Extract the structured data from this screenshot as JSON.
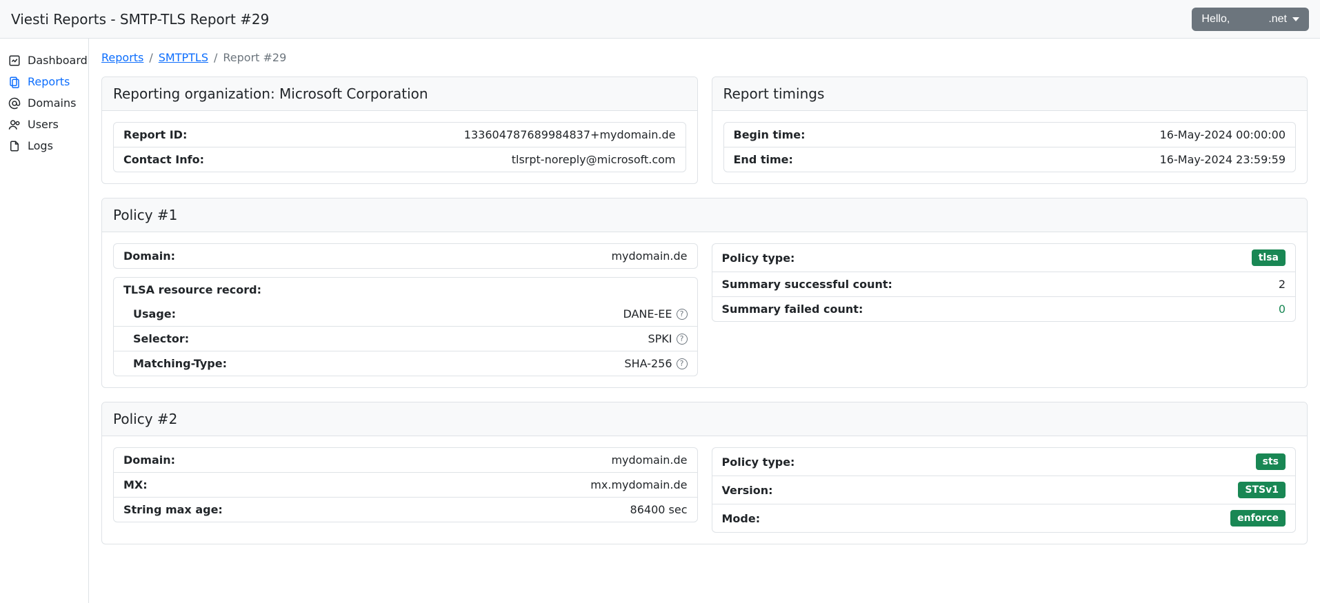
{
  "header": {
    "title": "Viesti Reports - SMTP-TLS Report #29",
    "hello": "Hello,",
    "user": ".net"
  },
  "sidebar": {
    "items": [
      {
        "label": "Dashboard"
      },
      {
        "label": "Reports"
      },
      {
        "label": "Domains"
      },
      {
        "label": "Users"
      },
      {
        "label": "Logs"
      }
    ]
  },
  "breadcrumb": {
    "reports": "Reports",
    "smtptls": "SMTPTLS",
    "current": "Report #29"
  },
  "reporting_org": {
    "title": "Reporting organization: Microsoft Corporation",
    "report_id_label": "Report ID:",
    "report_id_value": "133604787689984837+mydomain.de",
    "contact_label": "Contact Info:",
    "contact_value": "tlsrpt-noreply@microsoft.com"
  },
  "timings": {
    "title": "Report timings",
    "begin_label": "Begin time:",
    "begin_value": "16-May-2024 00:00:00",
    "end_label": "End time:",
    "end_value": "16-May-2024 23:59:59"
  },
  "policy1": {
    "title": "Policy #1",
    "domain_label": "Domain:",
    "domain_value": "mydomain.de",
    "tlsa_title": "TLSA resource record:",
    "usage_label": "Usage:",
    "usage_value": "DANE-EE",
    "selector_label": "Selector:",
    "selector_value": "SPKI",
    "matching_label": "Matching-Type:",
    "matching_value": "SHA-256",
    "policy_type_label": "Policy type:",
    "policy_type_value": "tlsa",
    "success_label": "Summary successful count:",
    "success_value": "2",
    "failed_label": "Summary failed count:",
    "failed_value": "0"
  },
  "policy2": {
    "title": "Policy #2",
    "domain_label": "Domain:",
    "domain_value": "mydomain.de",
    "mx_label": "MX:",
    "mx_value": "mx.mydomain.de",
    "maxage_label": "String max age:",
    "maxage_value": "86400 sec",
    "policy_type_label": "Policy type:",
    "policy_type_value": "sts",
    "version_label": "Version:",
    "version_value": "STSv1",
    "mode_label": "Mode:",
    "mode_value": "enforce"
  }
}
